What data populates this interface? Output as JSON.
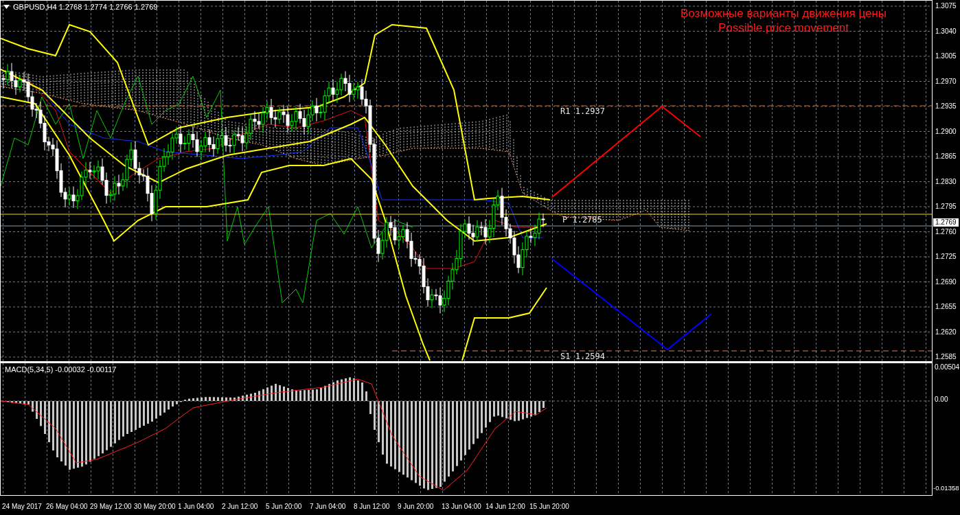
{
  "chart_header": {
    "text": "GBPUSD,H4 1.2768 1.2774 1.2766 1.2769"
  },
  "annotation": {
    "lines": [
      "Возможные варианты движения цены",
      "Possible price movement"
    ]
  },
  "pivot_levels": [
    {
      "label": "R1 1.2937",
      "kind": "resistance"
    },
    {
      "label": "P 1.2785",
      "kind": "pivot"
    },
    {
      "label": "S1 1.2594",
      "kind": "support"
    }
  ],
  "price_axis": {
    "labels": [
      "1.3075",
      "1.3040",
      "1.3005",
      "1.2970",
      "1.2935",
      "1.2900",
      "1.2865",
      "1.2830",
      "1.2795",
      "1.2760",
      "1.2725",
      "1.2690",
      "1.2655",
      "1.2620",
      "1.2585"
    ],
    "current_price": "1.2769"
  },
  "macd": {
    "title": "MACD(5,34,5) -0.00032 -0.00117",
    "axis_labels": [
      "0.00504",
      "0.00",
      "-0.01358"
    ]
  },
  "time_axis": {
    "labels": [
      "24 May 2017",
      "26 May 04:00",
      "29 May 12:00",
      "30 May 20:00",
      "1 Jun 04:00",
      "2 Jun 12:00",
      "5 Jun 20:00",
      "7 Jun 04:00",
      "8 Jun 12:00",
      "9 Jun 20:00",
      "13 Jun 04:00",
      "14 Jun 12:00",
      "15 Jun 20:00"
    ]
  }
}
